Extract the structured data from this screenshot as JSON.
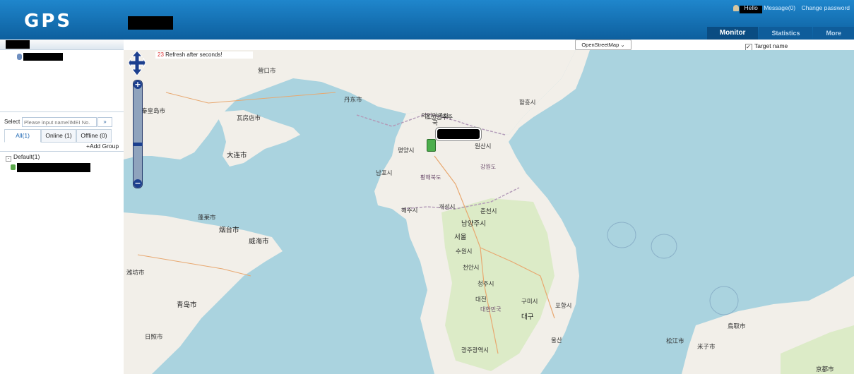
{
  "header": {
    "logo": "GPS",
    "user_links": [
      "Hello",
      "Message(0)",
      "Change password"
    ],
    "tabs": [
      {
        "label": "Monitor",
        "active": true
      },
      {
        "label": "Statistics",
        "active": false
      },
      {
        "label": "More",
        "active": false
      }
    ]
  },
  "sidebar": {
    "select_label": "Select :",
    "search_placeholder": "Please input name/IMEI No.",
    "status_tabs": [
      {
        "label": "All(1)",
        "active": true
      },
      {
        "label": "Online (1)",
        "active": false
      },
      {
        "label": "Offline (0)",
        "active": false
      }
    ],
    "add_group": "+Add Group",
    "group": "Default(1)"
  },
  "map": {
    "provider": "OpenStreetMap",
    "target_name_label": "Target name",
    "target_name_checked": true,
    "refresh_count": "23",
    "refresh_text": "Refresh after seconds!",
    "labels": {
      "pyongyang": "평양시",
      "nk_name_1": "조선민주주",
      "nk_name_2": "의인민공화",
      "nk_name_3": "국",
      "seoul": "서울",
      "dalian": "大连市",
      "qingdao": "青岛市",
      "yantai": "烟台市",
      "weihai": "威海市",
      "dandong": "丹东市",
      "qinhuangdao": "秦皇岛市",
      "yingkou": "营口市",
      "wafangdian": "瓦房店市",
      "daegu": "대구",
      "daejeon": "대전",
      "gwangju": "광주광역시",
      "korea": "대한민국",
      "cheongju": "청주시",
      "nampo": "남포시",
      "kaesong": "개성시",
      "haeju": "해주시",
      "wonsan": "원산시",
      "hamhung": "함흥시",
      "chuncheon": "춘천시",
      "namyangju": "남양주시",
      "suwon": "수원시",
      "cheonan": "천안시",
      "gumi": "구미시",
      "ulsan": "울산",
      "pohang": "포항시",
      "gangwon": "강원도",
      "hwanghae": "황해북도",
      "kyoto": "京都市",
      "tottori": "鳥取市",
      "matsue": "松江市",
      "yonezu": "米子市",
      "penglai": "蓬莱市",
      "rizhao": "日照市",
      "weifang": "潍坊市"
    }
  }
}
